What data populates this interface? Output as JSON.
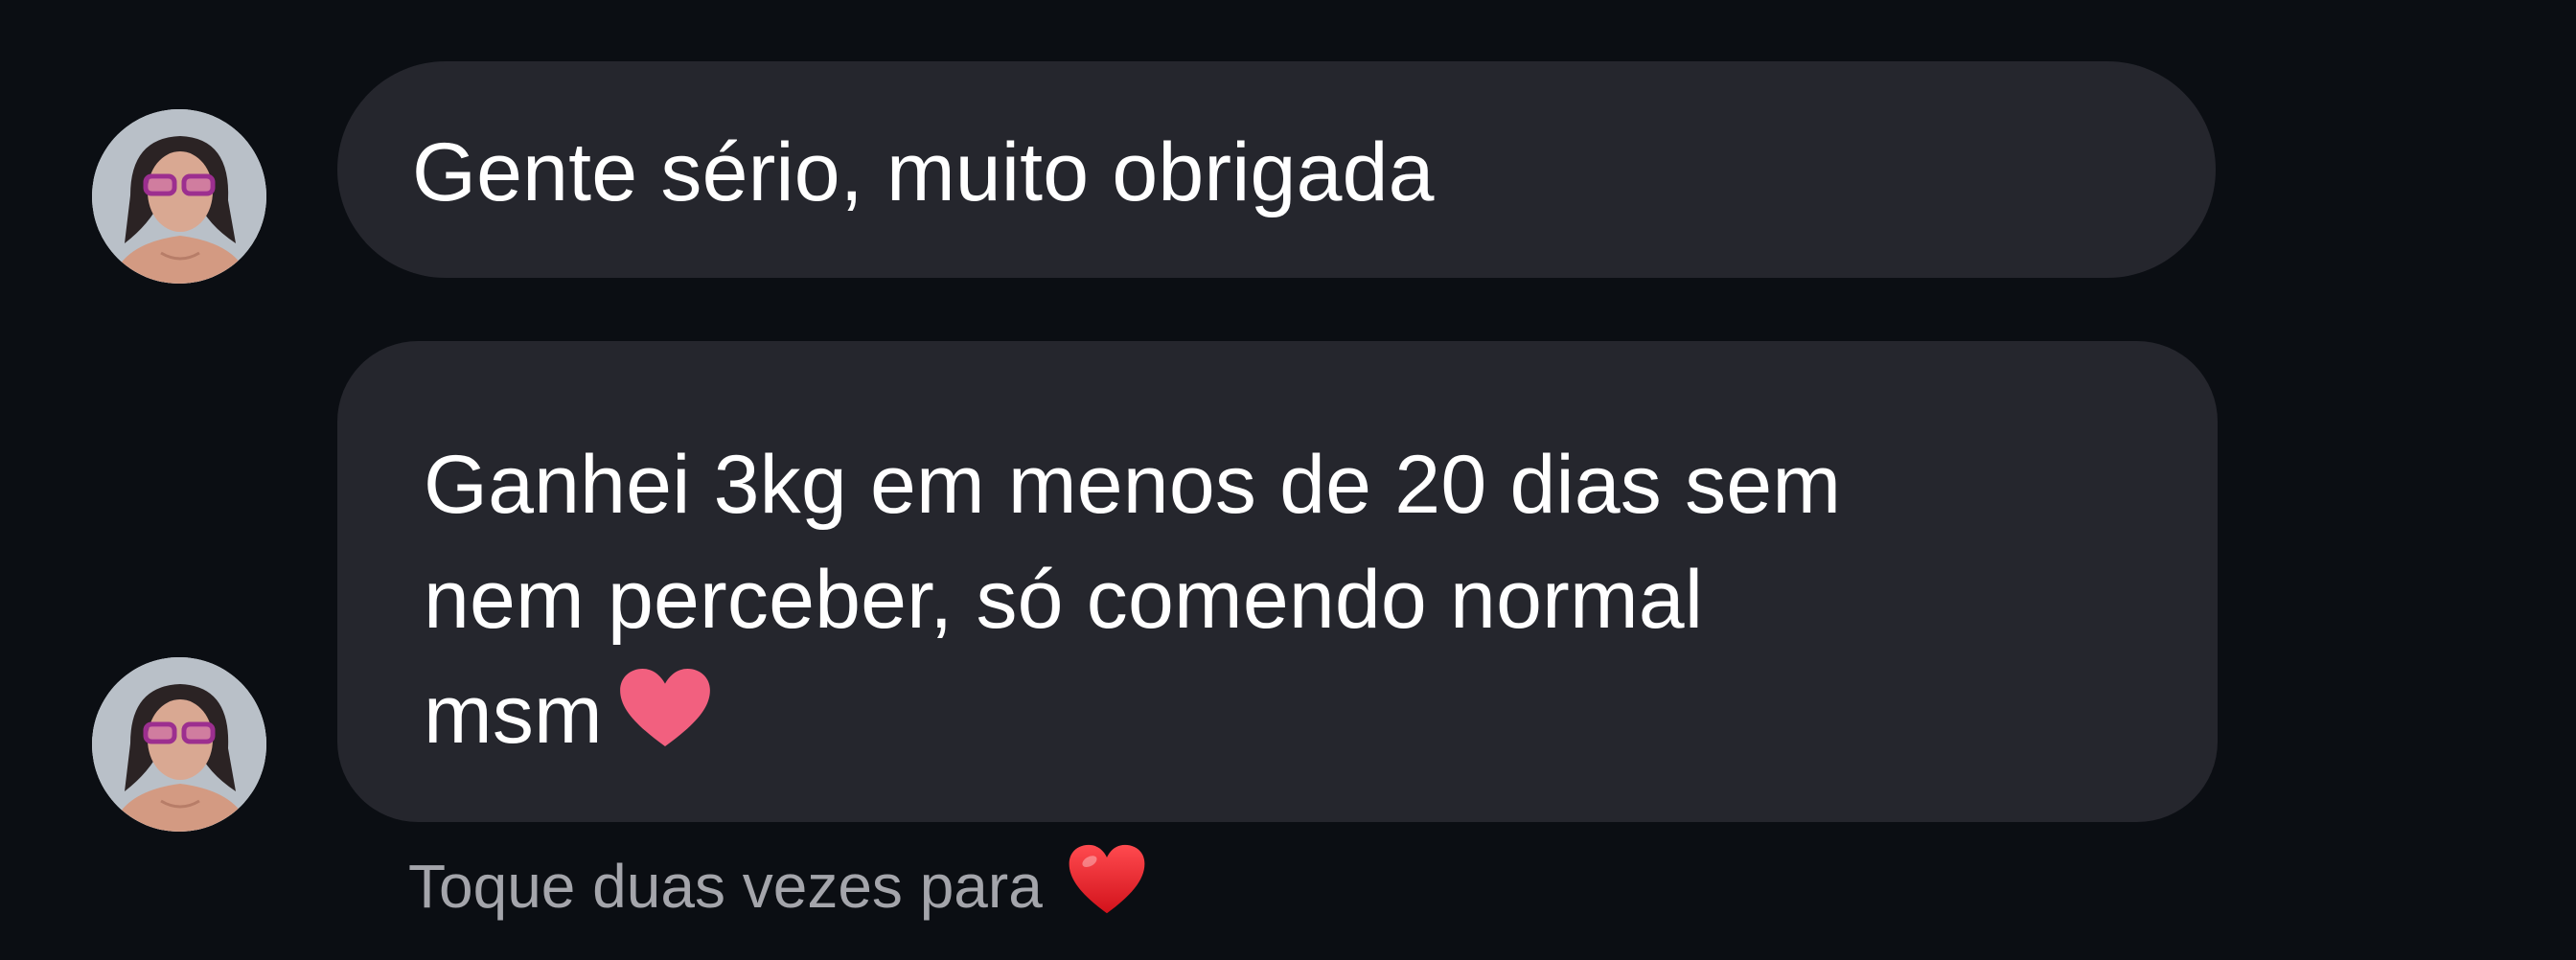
{
  "messages": [
    {
      "text": "Gente sério, muito obrigada"
    },
    {
      "lines": [
        "Ganhei 3kg em menos de 20 dias sem",
        "nem perceber, só comendo normal",
        "msm"
      ]
    }
  ],
  "icons": {
    "message_heart": "pink-heart-icon",
    "hint_heart": "red-heart-icon"
  },
  "hint": {
    "text": "Toque duas vezes para"
  },
  "colors": {
    "background": "#0b0e13",
    "bubble": "#25262d",
    "text": "#ffffff",
    "hint_text": "#a4a5ab",
    "pink_heart": "#f2607f",
    "red_heart": "#e5222b"
  }
}
